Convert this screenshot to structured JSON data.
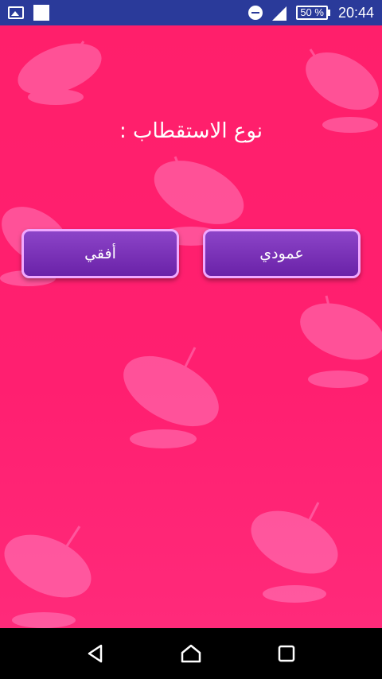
{
  "status_bar": {
    "battery_label": "50 %",
    "time": "20:44",
    "icons": [
      "gallery-icon",
      "square-icon",
      "do-not-disturb-icon",
      "signal-icon",
      "battery-icon"
    ]
  },
  "screen": {
    "title": "نوع الاستقطاب :",
    "buttons": {
      "vertical": "عمودي",
      "horizontal": "أفقي"
    }
  },
  "nav_bar": {
    "icons": [
      "back-icon",
      "home-icon",
      "recents-icon"
    ]
  },
  "colors": {
    "background": "#ff1f6e",
    "button": "#7a30b8",
    "button_border": "#f0a8ff",
    "status_bar": "#2a3a9a"
  }
}
